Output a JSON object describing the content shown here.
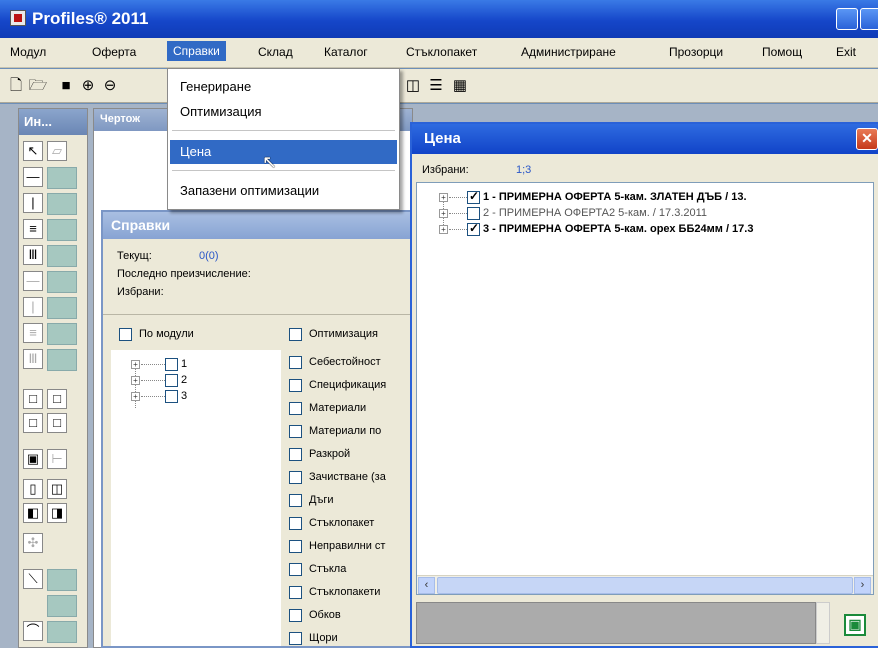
{
  "window": {
    "title": "Profiles® 2011"
  },
  "menubar": [
    {
      "label": "Модул"
    },
    {
      "label": "Оферта"
    },
    {
      "label": "Справки"
    },
    {
      "label": "Склад"
    },
    {
      "label": "Каталог"
    },
    {
      "label": "Стъклопакет"
    },
    {
      "label": "Администриране"
    },
    {
      "label": "Прозорци"
    },
    {
      "label": "Помощ"
    },
    {
      "label": "Exit"
    }
  ],
  "dropdown": {
    "items": [
      {
        "label": "Генериране"
      },
      {
        "label": "Оптимизация"
      },
      {
        "label": "Цена"
      },
      {
        "label": "Запазени оптимизации"
      }
    ]
  },
  "palette": {
    "title": "Ин..."
  },
  "drawing": {
    "title": "Чертож"
  },
  "spravki": {
    "title": "Справки",
    "current_label": "Текущ:",
    "current_value": "0(0)",
    "last_calc_label": "Последно преизчисление:",
    "selected_label": "Избрани:",
    "by_modules_label": "По модули",
    "optimization_label": "Оптимизация",
    "modules": [
      {
        "label": "1"
      },
      {
        "label": "2"
      },
      {
        "label": "3"
      }
    ],
    "report_options": [
      {
        "label": "Себестойност"
      },
      {
        "label": "Спецификация"
      },
      {
        "label": "Материали"
      },
      {
        "label": "Материали по"
      },
      {
        "label": "Разкрой"
      },
      {
        "label": "Зачистване (за"
      },
      {
        "label": "Дъги"
      },
      {
        "label": "Стъклопакет"
      },
      {
        "label": "Неправилни ст"
      },
      {
        "label": "Стъкла"
      },
      {
        "label": "Стъклопакети"
      },
      {
        "label": "Обков"
      },
      {
        "label": "Щори"
      }
    ]
  },
  "cena": {
    "title": "Цена",
    "selected_label": "Избрани:",
    "selected_value": "1;3",
    "offers": [
      {
        "label": "1 - ПРИМЕРНА ОФЕРТА 5-кам. ЗЛАТЕН ДЪБ / 13.",
        "checked": true
      },
      {
        "label": "2 - ПРИМЕРНА ОФЕРТА2 5-кам. / 17.3.2011",
        "checked": false
      },
      {
        "label": "3 - ПРИМЕРНА ОФЕРТА 5-кам. орех ББ24мм / 17.3",
        "checked": true
      }
    ]
  }
}
